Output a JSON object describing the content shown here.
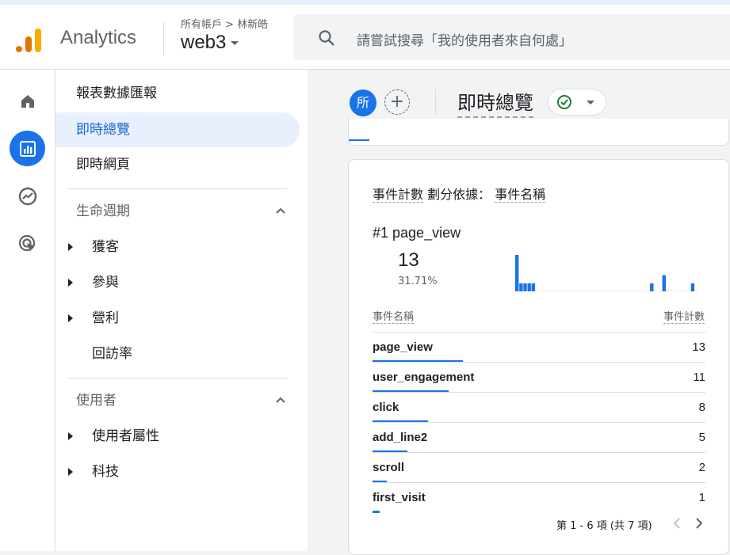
{
  "header": {
    "brand": "Analytics",
    "breadcrumb": "所有帳戶 > 林新皓",
    "property": "web3",
    "search_placeholder": "請嘗試搜尋「我的使用者來自何處」"
  },
  "rail": {
    "items": [
      "home-icon",
      "reports-icon",
      "explore-icon",
      "advertising-icon"
    ]
  },
  "nav": {
    "items": [
      {
        "label": "報表數據匯報",
        "selected": false
      },
      {
        "label": "即時總覽",
        "selected": true
      },
      {
        "label": "即時網頁",
        "selected": false
      }
    ],
    "lifecycle": {
      "label": "生命週期",
      "items": [
        "獲客",
        "參與",
        "營利",
        "回訪率"
      ]
    },
    "user": {
      "label": "使用者",
      "items": [
        "使用者屬性",
        "科技"
      ]
    }
  },
  "topbar": {
    "avatar": "所",
    "title": "即時總覽"
  },
  "card": {
    "title_parts": [
      "事件計數",
      "劃分依據：",
      "事件名稱"
    ],
    "rank": "#1  page_view",
    "value": "13",
    "percent": "31.71%",
    "col_name": "事件名稱",
    "col_count": "事件計數",
    "rows": [
      {
        "name": "page_view",
        "count": "13",
        "fraction": 1.0
      },
      {
        "name": "user_engagement",
        "count": "11",
        "fraction": 0.846
      },
      {
        "name": "click",
        "count": "8",
        "fraction": 0.615
      },
      {
        "name": "add_line2",
        "count": "5",
        "fraction": 0.385
      },
      {
        "name": "scroll",
        "count": "2",
        "fraction": 0.154
      },
      {
        "name": "first_visit",
        "count": "1",
        "fraction": 0.077
      }
    ],
    "pager": "第 1 - 6 項 (共 7 項)"
  },
  "sparkline_values": [
    9,
    2,
    2,
    2,
    2,
    0,
    0,
    0,
    0,
    0,
    0,
    0,
    0,
    0,
    0,
    0,
    0,
    0,
    0,
    0,
    0,
    0,
    0,
    0,
    0,
    0,
    0,
    0,
    0,
    0,
    0,
    0,
    0,
    2,
    0,
    0,
    4,
    0,
    0,
    0,
    0,
    0,
    0,
    2,
    0
  ],
  "colors": {
    "accent": "#1a73e8",
    "success": "#188038",
    "logo_orange": "#f9ab00",
    "logo_dark": "#e37400"
  }
}
